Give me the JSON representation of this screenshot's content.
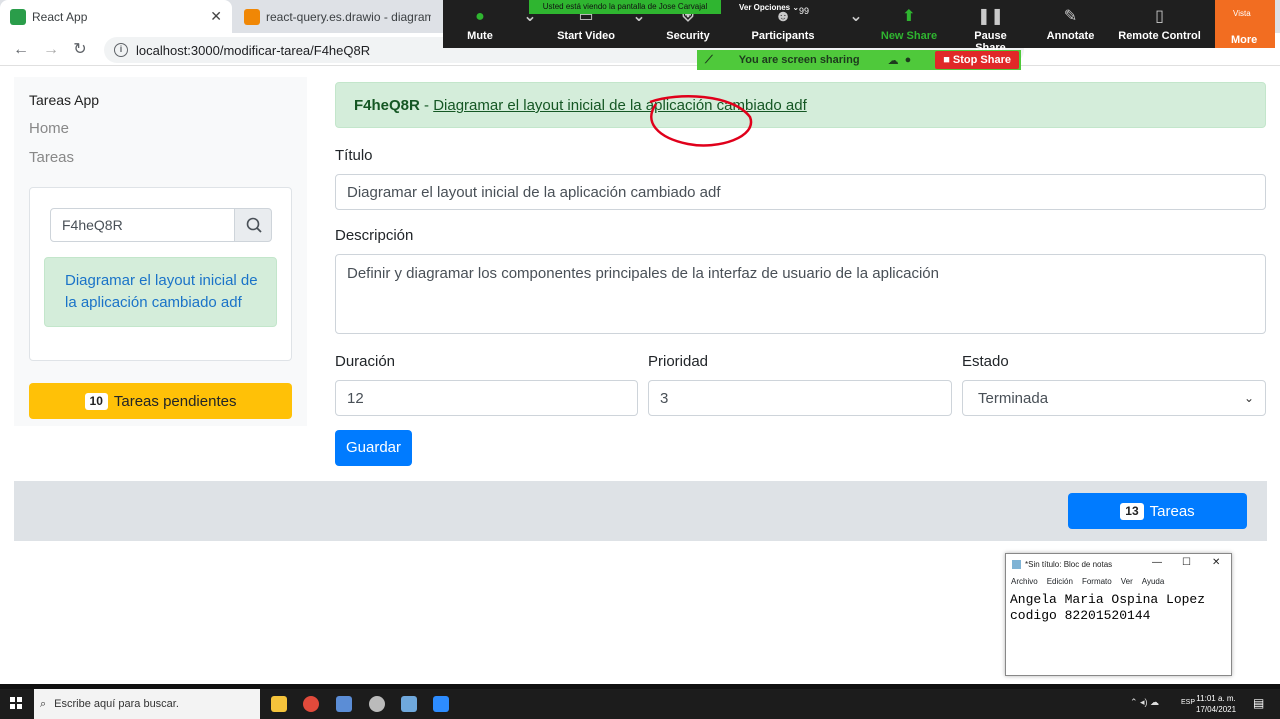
{
  "browser": {
    "tabs": [
      {
        "title": "React App",
        "active": true
      },
      {
        "title": "react-query.es.drawio - diagrams",
        "active": false
      }
    ],
    "url": "localhost:3000/modificar-tarea/F4heQ8R"
  },
  "zoom": {
    "viewing_banner": "Usted está viendo la pantalla de Jose Carvajal",
    "view_options": "Ver Opciones",
    "participants_count": "99",
    "buttons": [
      "Mute",
      "Start Video",
      "Security",
      "Participants",
      "New Share",
      "Pause Share",
      "Annotate",
      "Remote Control"
    ],
    "more_label": "More",
    "vista_label": "Vista",
    "sharing_text": "You are screen sharing",
    "stop_share": "Stop Share"
  },
  "sidebar": {
    "brand": "Tareas App",
    "links": [
      "Home",
      "Tareas"
    ],
    "search_value": "F4heQ8R",
    "result_text": "Diagramar el layout inicial de la aplicación cambiado adf",
    "pending_count": "10",
    "pending_label": "Tareas pendientes"
  },
  "main": {
    "alert_code": "F4heQ8R",
    "alert_separator": " - ",
    "alert_title": "Diagramar el layout inicial de la aplicación cambiado adf",
    "titulo_label": "Título",
    "titulo_value": "Diagramar el layout inicial de la aplicación cambiado adf",
    "descripcion_label": "Descripción",
    "descripcion_value": "Definir y diagramar los componentes principales de la interfaz de usuario de la aplicación",
    "duracion_label": "Duración",
    "duracion_value": "12",
    "prioridad_label": "Prioridad",
    "prioridad_value": "3",
    "estado_label": "Estado",
    "estado_value": "Terminada",
    "save_label": "Guardar"
  },
  "footer": {
    "tareas_count": "13",
    "tareas_label": "Tareas"
  },
  "notepad": {
    "title": "*Sin título: Bloc de notas",
    "menu": [
      "Archivo",
      "Edición",
      "Formato",
      "Ver",
      "Ayuda"
    ],
    "text": "Angela Maria Ospina Lopez\ncodigo 82201520144"
  },
  "taskbar": {
    "search_placeholder": "Escribe aquí para buscar.",
    "lang": "ESP",
    "time": "11:01 a. m.",
    "date": "17/04/2021"
  },
  "colors": {
    "primary": "#007bff",
    "warning": "#ffc107",
    "success_bg": "#d4edda",
    "zoom_orange": "#f26d21",
    "annotation_red": "#e0001b"
  }
}
